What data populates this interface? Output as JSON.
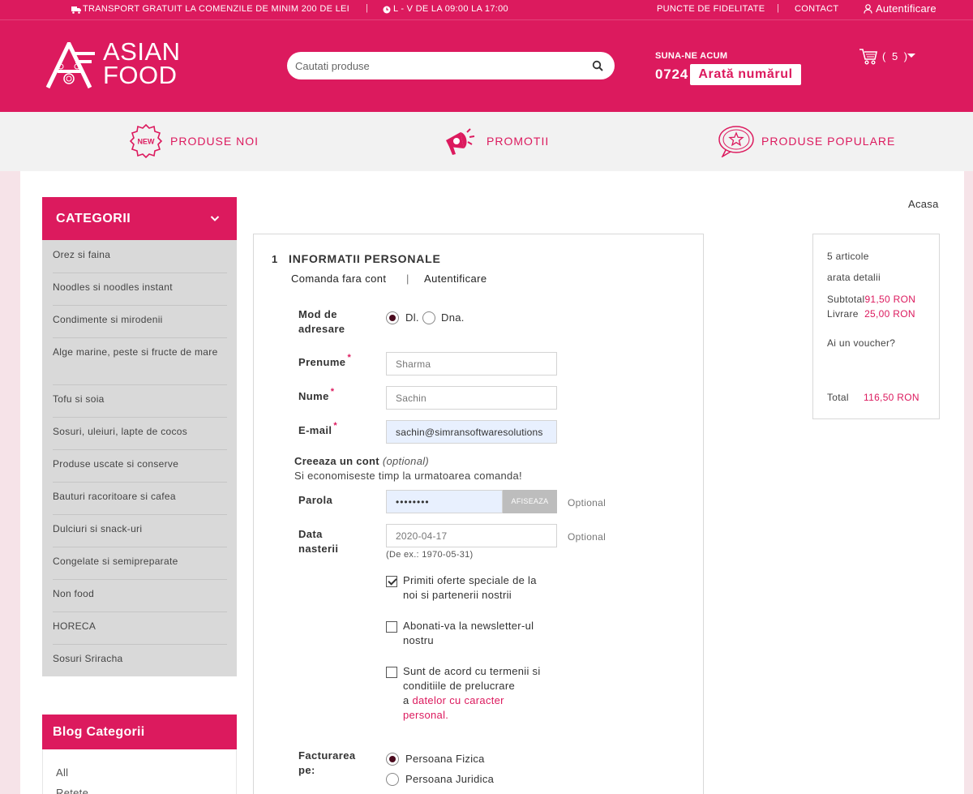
{
  "topbar": {
    "shipping": "TRANSPORT GRATUIT LA COMENZILE DE MINIM 200 DE LEI",
    "hours": "L - V DE LA 09:00 LA 17:00",
    "loyalty": "PUNCTE DE FIDELITATE",
    "contact": "CONTACT",
    "login": "Autentificare"
  },
  "header": {
    "logo_line1": "ASIAN",
    "logo_line2": "FOOD",
    "search_placeholder": "Cautati produse",
    "call_label": "SUNA-NE ACUM",
    "phone_prefix": "0724",
    "show_number": "Arată numărul",
    "cart_count": "( 5 )"
  },
  "nav": {
    "new_badge": "NEW",
    "new_products": "PRODUSE NOI",
    "promotions": "PROMOTII",
    "popular": "PRODUSE POPULARE"
  },
  "sidebar": {
    "title": "CATEGORII",
    "categories": [
      "Orez si faina",
      "Noodles si noodles instant",
      "Condimente si mirodenii",
      "Alge marine, peste si fructe de mare",
      "Tofu si soia",
      "Sosuri, uleiuri, lapte de cocos",
      "Produse uscate si conserve",
      "Bauturi racoritoare si cafea",
      "Dulciuri si snack-uri",
      "Congelate si semipreparate",
      "Non food",
      "HORECA",
      "Sosuri Sriracha"
    ],
    "blog_title": "Blog Categorii",
    "blog_items": [
      "All",
      "Retete"
    ]
  },
  "breadcrumb": "Acasa",
  "checkout": {
    "step_number": "1",
    "step_title": "INFORMATII PERSONALE",
    "tab_guest": "Comanda fara cont",
    "tab_separator": "|",
    "tab_login": "Autentificare",
    "salutation_label_1": "Mod de",
    "salutation_label_2": "adresare",
    "salutation_options": [
      "Dl.",
      "Dna."
    ],
    "required_mark": "*",
    "firstname_label": "Prenume",
    "firstname_value": "Sharma",
    "lastname_label": "Nume",
    "lastname_value": "Sachin",
    "email_label": "E-mail",
    "email_value": "sachin@simransoftwaresolutions",
    "create_account": "Creeaza un cont",
    "optional_paren": "(optional)",
    "save_time": "Si economiseste timp la urmatoarea comanda!",
    "password_label": "Parola",
    "password_value": "••••••••",
    "show_button": "AFISEAZA",
    "optional": "Optional",
    "birthdate_label_1": "Data",
    "birthdate_label_2": "nasterii",
    "birthdate_value": "2020-04-17",
    "birthdate_hint": "(De ex.: 1970-05-31)",
    "offers_1": "Primiti oferte speciale de la",
    "offers_2": "noi si partenerii nostrii",
    "newsletter_1": "Abonati-va la newsletter-ul",
    "newsletter_2": "nostru",
    "terms_1": "Sunt de acord cu termenii si",
    "terms_2": "conditiile de prelucrare",
    "terms_3": "a",
    "terms_link_1": "datelor cu caracter",
    "terms_link_2": "personal",
    "terms_end": ".",
    "billing_label_1": "Facturarea",
    "billing_label_2": "pe:",
    "billing_person": "Persoana Fizica",
    "billing_company": "Persoana Juridica"
  },
  "summary": {
    "items": "5 articole",
    "details": "arata detalii",
    "subtotal_label": "Subtotal",
    "subtotal_value": "91,50 RON",
    "shipping_label": "Livrare",
    "shipping_value": "25,00 RON",
    "voucher": "Ai un voucher?",
    "total_label": "Total",
    "total_value": "116,50 RON"
  },
  "colors": {
    "brand": "#dc1a5e",
    "sidebar_bg": "#d9d9d9",
    "nav_bg": "#f2f2f2"
  },
  "icons": [
    "truck-icon",
    "clock-icon",
    "user-icon",
    "search-icon",
    "cart-icon",
    "chevron-down-icon",
    "new-badge-icon",
    "megaphone-icon",
    "star-bubble-icon",
    "check-icon"
  ]
}
